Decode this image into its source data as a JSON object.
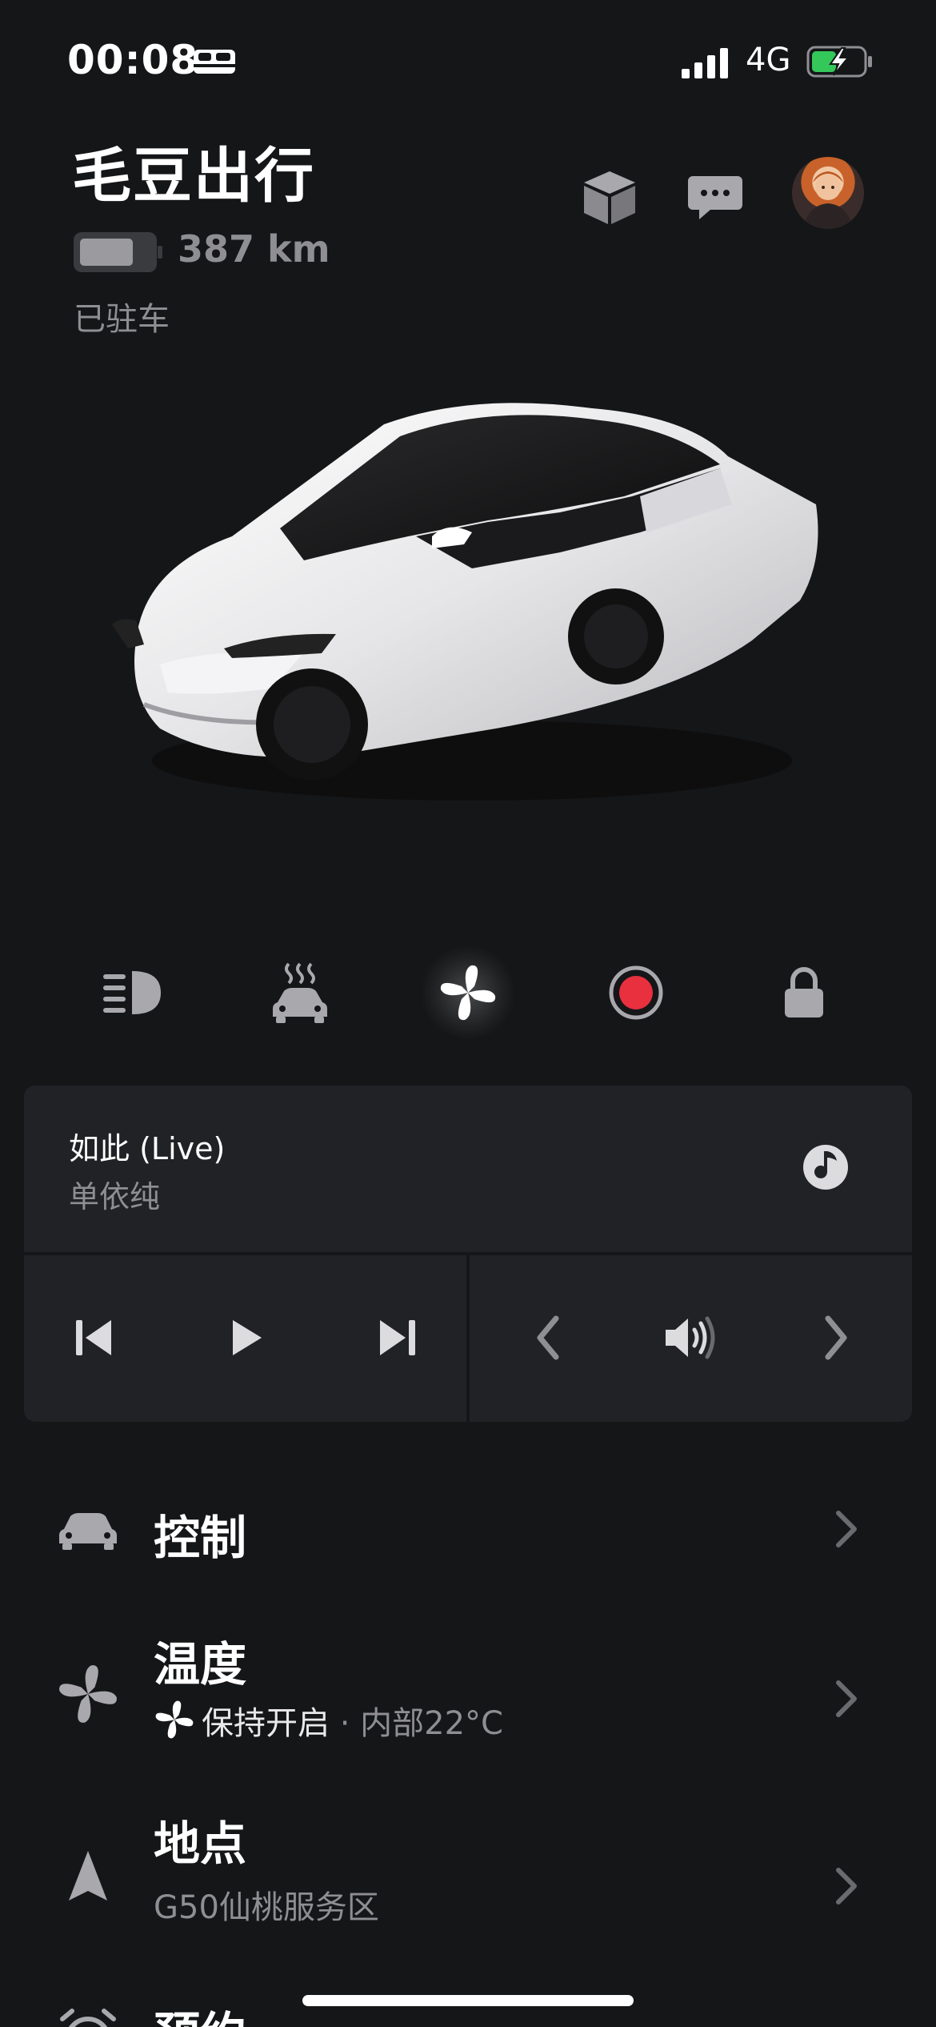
{
  "status_bar": {
    "time": "00:08",
    "network": "4G"
  },
  "header": {
    "car_name": "毛豆出行",
    "range": "387 km",
    "park_status": "已驻车"
  },
  "media": {
    "song_title": "如此 (Live)",
    "artist": "单依纯"
  },
  "menu": {
    "control": {
      "title": "控制"
    },
    "climate": {
      "title": "温度",
      "status": "保持开启",
      "detail": " · 内部22°C"
    },
    "location": {
      "title": "地点",
      "place": "G50仙桃服务区"
    },
    "schedule": {
      "title": "预约"
    }
  },
  "colors": {
    "background": "#151618",
    "card": "#212225",
    "secondary_text": "#8e8e93",
    "record_red": "#e8303e",
    "charging_green": "#34c759"
  },
  "icons": [
    "sleep-icon",
    "signal-icon",
    "battery-charging-icon",
    "cube-icon",
    "message-icon",
    "headlight-icon",
    "defrost-car-icon",
    "fan-icon",
    "record-icon",
    "lock-icon",
    "music-source-icon",
    "skip-back-icon",
    "play-icon",
    "skip-forward-icon",
    "chevron-left-icon",
    "volume-icon",
    "chevron-right-icon",
    "car-icon",
    "navigation-arrow-icon",
    "alarm-icon"
  ]
}
